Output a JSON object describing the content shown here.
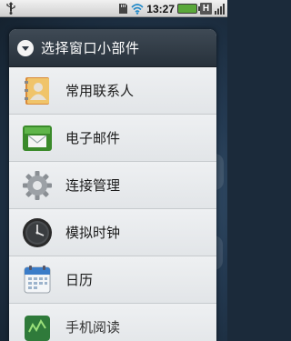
{
  "statusbar": {
    "time": "13:27",
    "network_badge": "H",
    "icons": [
      "usb-icon",
      "sd-card-icon",
      "wifi-icon",
      "battery-icon",
      "hspa-icon",
      "signal-icon"
    ],
    "battery_color": "#5aa83a"
  },
  "dialog": {
    "title": "选择窗口小部件",
    "header_icon": "chevron-down-circle-icon",
    "header_color": "#2e3843"
  },
  "widgets": [
    {
      "label": "常用联系人",
      "icon": "contacts-icon"
    },
    {
      "label": "电子邮件",
      "icon": "email-icon"
    },
    {
      "label": "连接管理",
      "icon": "gear-icon"
    },
    {
      "label": "模拟时钟",
      "icon": "analog-clock-icon"
    },
    {
      "label": "日历",
      "icon": "calendar-icon"
    },
    {
      "label": "手机阅读",
      "icon": "phone-reading-icon"
    }
  ]
}
